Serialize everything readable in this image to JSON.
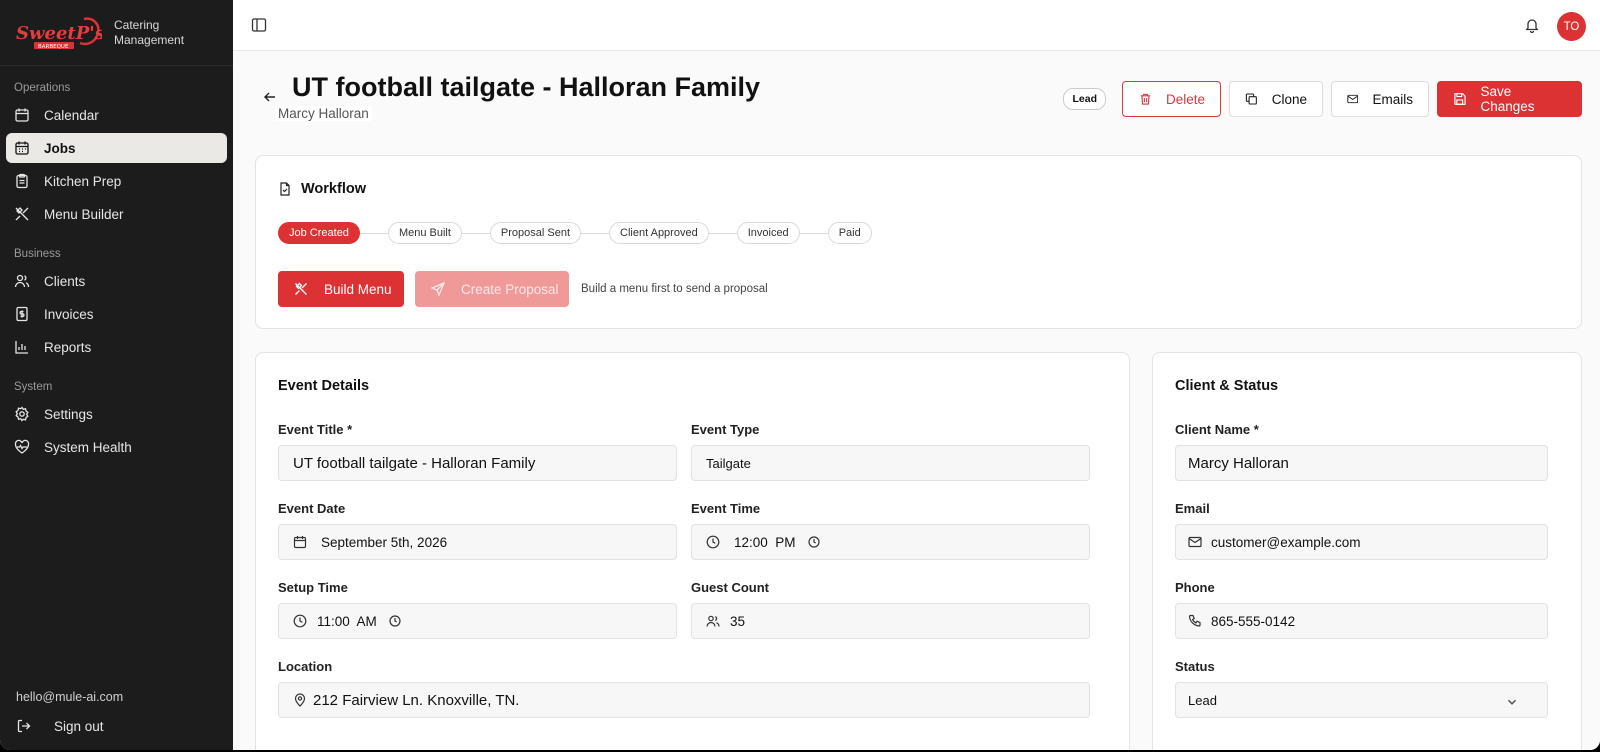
{
  "brand": {
    "logo_text": "SweetP's Barbeque",
    "subtitle_line1": "Catering",
    "subtitle_line2": "Management"
  },
  "sidebar": {
    "sections": [
      {
        "heading": "Operations",
        "items": [
          {
            "label": "Calendar",
            "icon": "calendar-icon"
          },
          {
            "label": "Jobs",
            "icon": "calendar-icon",
            "active": true
          },
          {
            "label": "Kitchen Prep",
            "icon": "clipboard-icon"
          },
          {
            "label": "Menu Builder",
            "icon": "utensils-icon"
          }
        ]
      },
      {
        "heading": "Business",
        "items": [
          {
            "label": "Clients",
            "icon": "users-icon"
          },
          {
            "label": "Invoices",
            "icon": "receipt-icon"
          },
          {
            "label": "Reports",
            "icon": "bar-chart-icon"
          }
        ]
      },
      {
        "heading": "System",
        "items": [
          {
            "label": "Settings",
            "icon": "gear-icon"
          },
          {
            "label": "System Health",
            "icon": "heart-pulse-icon"
          }
        ]
      }
    ],
    "user_email": "hello@mule-ai.com",
    "sign_out": "Sign out"
  },
  "topbar": {
    "avatar_initials": "TO"
  },
  "header": {
    "title": "UT football tailgate - Halloran Family",
    "subtitle": "Marcy Halloran",
    "status_badge": "Lead",
    "delete_label": "Delete",
    "clone_label": "Clone",
    "emails_label": "Emails",
    "save_label": "Save Changes"
  },
  "workflow": {
    "title": "Workflow",
    "steps": [
      "Job Created",
      "Menu Built",
      "Proposal Sent",
      "Client Approved",
      "Invoiced",
      "Paid"
    ],
    "active_step": "Job Created",
    "build_menu_label": "Build Menu",
    "create_proposal_label": "Create Proposal",
    "hint": "Build a menu first to send a proposal"
  },
  "event": {
    "title": "Event Details",
    "event_title_label": "Event Title *",
    "event_title_value": "UT football tailgate - Halloran Family",
    "event_type_label": "Event Type",
    "event_type_value": "Tailgate",
    "event_date_label": "Event Date",
    "event_date_value": "September 5th, 2026",
    "event_time_label": "Event Time",
    "event_time_value": "12:00  PM",
    "setup_time_label": "Setup Time",
    "setup_time_value": "11:00  AM",
    "guest_count_label": "Guest Count",
    "guest_count_value": "35",
    "location_label": "Location",
    "location_value": "212 Fairview Ln. Knoxville, TN."
  },
  "client": {
    "title": "Client & Status",
    "name_label": "Client Name *",
    "name_value": "Marcy Halloran",
    "email_label": "Email",
    "email_value": "customer@example.com",
    "phone_label": "Phone",
    "phone_value": "865-555-0142",
    "status_label": "Status",
    "status_value": "Lead"
  },
  "colors": {
    "accent": "#dc3234",
    "sidebar_bg": "#1c1c1c"
  }
}
